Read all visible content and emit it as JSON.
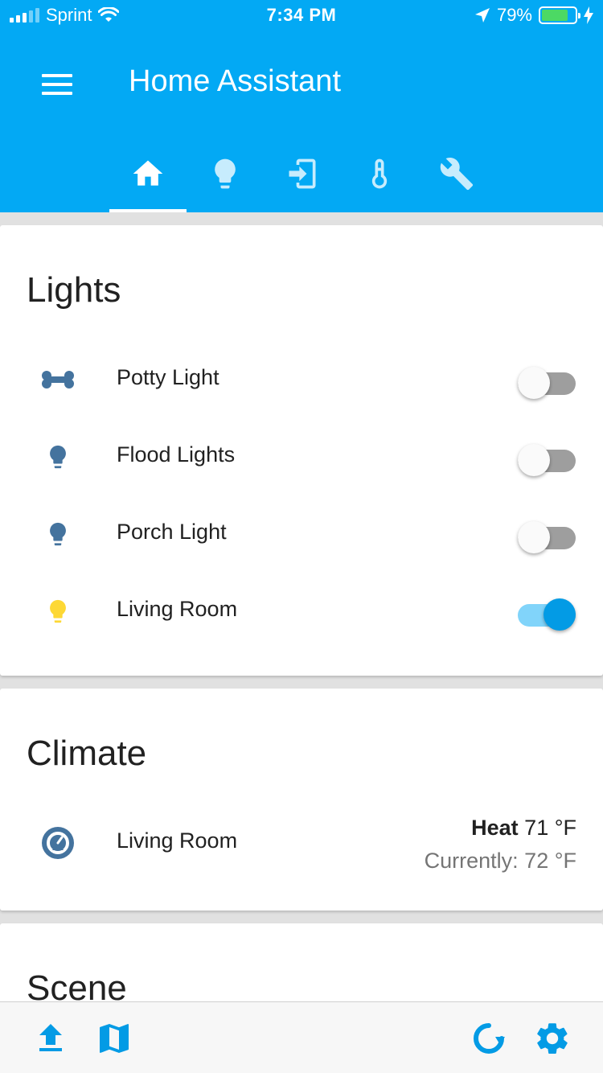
{
  "status_bar": {
    "carrier": "Sprint",
    "time": "7:34 PM",
    "battery": "79%",
    "battery_level": 0.79
  },
  "header": {
    "title": "Home Assistant",
    "menu_icon": "menu-icon",
    "tabs": [
      {
        "icon": "home-icon",
        "active": true
      },
      {
        "icon": "lightbulb-icon",
        "active": false
      },
      {
        "icon": "login-icon",
        "active": false
      },
      {
        "icon": "thermometer-icon",
        "active": false
      },
      {
        "icon": "wrench-icon",
        "active": false
      }
    ]
  },
  "lights": {
    "title": "Lights",
    "items": [
      {
        "label": "Potty Light",
        "icon": "bone-icon",
        "state": "off",
        "icon_color": "#44739e"
      },
      {
        "label": "Flood Lights",
        "icon": "lightbulb-icon",
        "state": "off",
        "icon_color": "#44739e"
      },
      {
        "label": "Porch Light",
        "icon": "lightbulb-icon",
        "state": "off",
        "icon_color": "#44739e"
      },
      {
        "label": "Living Room",
        "icon": "lightbulb-icon",
        "state": "on",
        "icon_color": "#fdd835"
      }
    ]
  },
  "climate": {
    "title": "Climate",
    "items": [
      {
        "label": "Living Room",
        "icon": "thermostat-icon",
        "mode": "Heat",
        "target": "71 °F",
        "current": "Currently: 72 °F"
      }
    ]
  },
  "scene": {
    "title": "Scene"
  },
  "bottom_bar": {
    "left": [
      "upload-icon",
      "map-icon"
    ],
    "right": [
      "refresh-icon",
      "settings-icon"
    ]
  },
  "colors": {
    "primary": "#03a9f4",
    "state_icon": "#44739e",
    "light_on": "#fdd835",
    "toggle_on": "#039be5"
  }
}
